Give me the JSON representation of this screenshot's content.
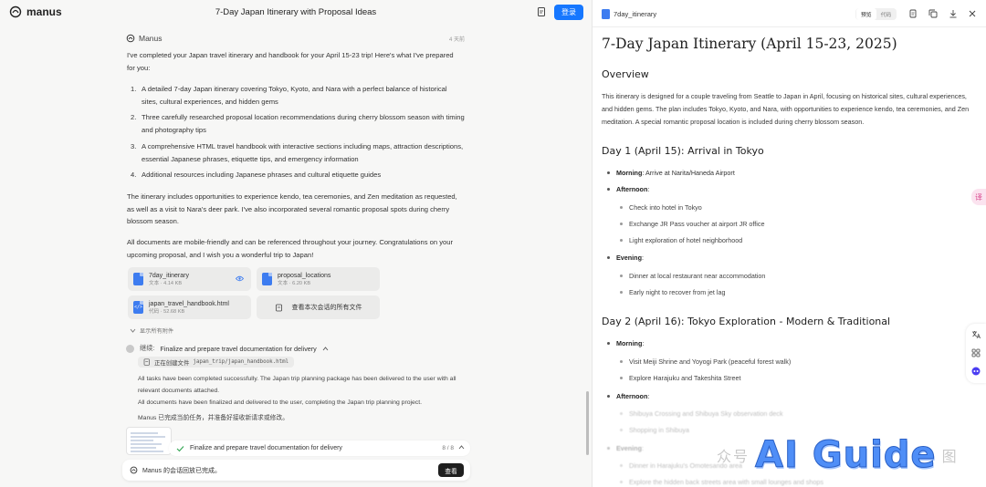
{
  "app": {
    "brand": "manus",
    "page_title": "7-Day Japan Itinerary with Proposal Ideas",
    "login_label": "登录"
  },
  "chat": {
    "sender": "Manus",
    "time": "4 天前",
    "intro": "I've completed your Japan travel itinerary and handbook for your April 15-23 trip! Here's what I've prepared for you:",
    "list": [
      {
        "num": "1.",
        "text": "A detailed 7-day Japan itinerary covering Tokyo, Kyoto, and Nara with a perfect balance of historical sites, cultural experiences, and hidden gems"
      },
      {
        "num": "2.",
        "text": "Three carefully researched proposal location recommendations during cherry blossom season with timing and photography tips"
      },
      {
        "num": "3.",
        "text": "A comprehensive HTML travel handbook with interactive sections including maps, attraction descriptions, essential Japanese phrases, etiquette tips, and emergency information"
      },
      {
        "num": "4.",
        "text": "Additional resources including Japanese phrases and cultural etiquette guides"
      }
    ],
    "para2": "The itinerary includes opportunities to experience kendo, tea ceremonies, and Zen meditation as requested, as well as a visit to Nara's deer park. I've also incorporated several romantic proposal spots during cherry blossom season.",
    "para3": "All documents are mobile-friendly and can be referenced throughout your journey. Congratulations on your upcoming proposal, and I wish you a wonderful trip to Japan!",
    "attachments": [
      {
        "name": "7day_itinerary",
        "meta": "文本 · 4.14 KB",
        "type": "doc"
      },
      {
        "name": "proposal_locations",
        "meta": "文本 · 6.20 KB",
        "type": "doc"
      },
      {
        "name": "japan_travel_handbook.html",
        "meta": "代码 · 52.68 KB",
        "type": "code"
      }
    ],
    "view_all_files": "查看本次会话的所有文件",
    "show_all_attachments": "显示所有附件",
    "task_prefix": "继续:",
    "task_title": "Finalize and prepare travel documentation for delivery",
    "cmd_label": "正在创建文件",
    "cmd_path": "japan_trip/japan_handbook.html",
    "sub1": "All tasks have been completed successfully. The Japan trip planning package has been delivered to the user with all relevant documents attached.",
    "sub2": "All documents have been finalized and delivered to the user, completing the Japan trip planning project.",
    "sub3": "Manus 已完成当前任务，并准备好接收新请求或修改。",
    "progress_text": "Finalize and prepare travel documentation for delivery",
    "progress_count": "8 / 8",
    "status_text": "Manus 的会话回放已完成。",
    "view_label": "查看"
  },
  "viewer": {
    "filename": "7day_itinerary",
    "tab_preview": "预览",
    "tab_code": "代码",
    "h1": "7-Day Japan Itinerary (April 15-23, 2025)",
    "overview_h": "Overview",
    "overview_p": "This itinerary is designed for a couple traveling from Seattle to Japan in April, focusing on historical sites, cultural experiences, and hidden gems. The plan includes Tokyo, Kyoto, and Nara, with opportunities to experience kendo, tea ceremonies, and Zen meditation. A special romantic proposal location is included during cherry blossom season.",
    "day1_h": "Day 1 (April 15): Arrival in Tokyo",
    "day1": {
      "morning_label": "Morning",
      "morning_text": ": Arrive at Narita/Haneda Airport",
      "afternoon_label": "Afternoon",
      "afternoon_suffix": ":",
      "afternoon_items": [
        "Check into hotel in Tokyo",
        "Exchange JR Pass voucher at airport JR office",
        "Light exploration of hotel neighborhood"
      ],
      "evening_label": "Evening",
      "evening_suffix": ":",
      "evening_items": [
        "Dinner at local restaurant near accommodation",
        "Early night to recover from jet lag"
      ]
    },
    "day2_h": "Day 2 (April 16): Tokyo Exploration - Modern & Traditional",
    "day2": {
      "morning_label": "Morning",
      "morning_suffix": ":",
      "morning_items": [
        "Visit Meiji Shrine and Yoyogi Park (peaceful forest walk)",
        "Explore Harajuku and Takeshita Street"
      ],
      "afternoon_label": "Afternoon",
      "afternoon_suffix": ":",
      "afternoon_items": [
        "Shibuya Crossing and Shibuya Sky observation deck",
        "Shopping in Shibuya"
      ],
      "evening_label": "Evening",
      "evening_suffix": ":",
      "evening_items": [
        "Dinner in Harajuku's Omotesando area",
        "Explore the hidden back streets area with small lounges and shops"
      ]
    }
  },
  "watermark": {
    "left": "众号",
    "big": "AI Guide",
    "right": "图"
  },
  "side": {
    "pill_text": "译"
  },
  "colors": {
    "accent": "#1677ff",
    "doc_icon": "#3d7cf0",
    "watermark": "#4f8ef7"
  }
}
